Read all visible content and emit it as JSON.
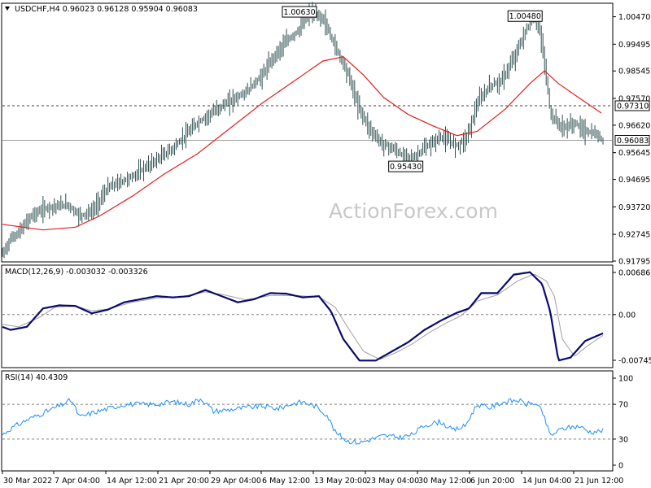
{
  "header": "USDCHF,H4  0.96023 0.96128 0.95904 0.96083",
  "watermark": "ActionForex.com",
  "colors": {
    "candle": "#2f4f4f",
    "ma": "#e41e1e",
    "macd": "#0a0a6e",
    "signal": "#a0a0a0",
    "rsi": "#1e90ff",
    "hline": "#808080"
  },
  "chart_data": [
    {
      "type": "line",
      "title": "USDCHF,H4",
      "price_axis": [
        "1.00470",
        "0.99495",
        "0.98545",
        "0.97570",
        "0.96620",
        "0.95645",
        "0.94695",
        "0.93720",
        "0.92745",
        "0.91795"
      ],
      "ylim": [
        0.91795,
        1.0092
      ],
      "x_labels": [
        "30 Mar 2022",
        "7 Apr 04:00",
        "14 Apr 12:00",
        "21 Apr 20:00",
        "29 Apr 04:00",
        "6 May 12:00",
        "13 May 20:00",
        "23 May 04:00",
        "30 May 12:00",
        "6 Jun 20:00",
        "14 Jun 04:00",
        "21 Jun 12:00"
      ],
      "price_knots": [
        [
          0,
          0.9205
        ],
        [
          10,
          0.926
        ],
        [
          20,
          0.928
        ],
        [
          35,
          0.934
        ],
        [
          55,
          0.937
        ],
        [
          80,
          0.938
        ],
        [
          95,
          0.934
        ],
        [
          110,
          0.9355
        ],
        [
          130,
          0.944
        ],
        [
          160,
          0.948
        ],
        [
          185,
          0.953
        ],
        [
          210,
          0.958
        ],
        [
          240,
          0.967
        ],
        [
          270,
          0.973
        ],
        [
          300,
          0.978
        ],
        [
          320,
          0.984
        ],
        [
          335,
          0.991
        ],
        [
          350,
          0.996
        ],
        [
          365,
          1.0
        ],
        [
          378,
          1.0063
        ],
        [
          395,
          1.004
        ],
        [
          410,
          0.994
        ],
        [
          425,
          0.985
        ],
        [
          438,
          0.973
        ],
        [
          452,
          0.965
        ],
        [
          466,
          0.96
        ],
        [
          480,
          0.958
        ],
        [
          495,
          0.955
        ],
        [
          505,
          0.9543
        ],
        [
          520,
          0.958
        ],
        [
          540,
          0.962
        ],
        [
          560,
          0.959
        ],
        [
          572,
          0.962
        ],
        [
          585,
          0.974
        ],
        [
          600,
          0.98
        ],
        [
          615,
          0.982
        ],
        [
          630,
          0.99
        ],
        [
          645,
          1.0
        ],
        [
          656,
          1.0048
        ],
        [
          662,
          1.0
        ],
        [
          670,
          0.983
        ],
        [
          675,
          0.97
        ],
        [
          690,
          0.965
        ],
        [
          705,
          0.967
        ],
        [
          718,
          0.964
        ],
        [
          730,
          0.963
        ],
        [
          741,
          0.9608
        ]
      ],
      "ma_knots": [
        [
          0,
          0.931
        ],
        [
          50,
          0.929
        ],
        [
          90,
          0.93
        ],
        [
          120,
          0.934
        ],
        [
          160,
          0.941
        ],
        [
          200,
          0.949
        ],
        [
          240,
          0.956
        ],
        [
          280,
          0.965
        ],
        [
          320,
          0.974
        ],
        [
          360,
          0.982
        ],
        [
          395,
          0.989
        ],
        [
          420,
          0.9905
        ],
        [
          445,
          0.984
        ],
        [
          470,
          0.976
        ],
        [
          500,
          0.97
        ],
        [
          530,
          0.966
        ],
        [
          560,
          0.9625
        ],
        [
          585,
          0.964
        ],
        [
          620,
          0.972
        ],
        [
          650,
          0.981
        ],
        [
          668,
          0.9855
        ],
        [
          685,
          0.981
        ],
        [
          710,
          0.976
        ],
        [
          738,
          0.9705
        ]
      ],
      "annotations": [
        {
          "text": "1.00630",
          "x": 378,
          "y": 1.0063
        },
        {
          "text": "0.95430",
          "x": 505,
          "y": 0.9543
        },
        {
          "text": "1.00480",
          "x": 656,
          "y": 1.0048
        }
      ],
      "hlines": [
        {
          "label": "0.97310",
          "y": 0.9731,
          "style": "dashed"
        },
        {
          "label": "0.96083",
          "y": 0.96083,
          "style": "solid"
        }
      ]
    },
    {
      "type": "line",
      "title": "MACD(12,26,9) -0.003032 -0.003326",
      "ylim": [
        -0.007454,
        0.006861
      ],
      "axis_labels": [
        "0.006861",
        "0.00",
        "-0.007454"
      ],
      "series": [
        {
          "values": [
            [
              0,
              -0.002
            ],
            [
              10,
              -0.0025
            ],
            [
              30,
              -0.002
            ],
            [
              50,
              0.001
            ],
            [
              70,
              0.0015
            ],
            [
              90,
              0.0014
            ],
            [
              110,
              0.0002
            ],
            [
              130,
              0.0008
            ],
            [
              150,
              0.002
            ],
            [
              170,
              0.0025
            ],
            [
              190,
              0.003
            ],
            [
              210,
              0.0028
            ],
            [
              230,
              0.003
            ],
            [
              250,
              0.004
            ],
            [
              270,
              0.003
            ],
            [
              290,
              0.002
            ],
            [
              310,
              0.0025
            ],
            [
              330,
              0.0035
            ],
            [
              350,
              0.0034
            ],
            [
              370,
              0.0028
            ],
            [
              390,
              0.003
            ],
            [
              405,
              0.0005
            ],
            [
              420,
              -0.004
            ],
            [
              440,
              -0.0075
            ],
            [
              460,
              -0.0075
            ],
            [
              480,
              -0.006
            ],
            [
              500,
              -0.0045
            ],
            [
              520,
              -0.0025
            ],
            [
              540,
              -0.001
            ],
            [
              560,
              0.0003
            ],
            [
              575,
              0.001
            ],
            [
              590,
              0.0035
            ],
            [
              610,
              0.0035
            ],
            [
              630,
              0.0065
            ],
            [
              650,
              0.0069
            ],
            [
              665,
              0.005
            ],
            [
              675,
              0.0005
            ],
            [
              685,
              -0.0075
            ],
            [
              700,
              -0.007
            ],
            [
              718,
              -0.0043
            ],
            [
              741,
              -0.003
            ]
          ]
        },
        {
          "values": [
            [
              0,
              -0.0016
            ],
            [
              20,
              -0.002
            ],
            [
              45,
              -0.0005
            ],
            [
              65,
              0.0012
            ],
            [
              90,
              0.0014
            ],
            [
              110,
              0.0006
            ],
            [
              130,
              0.0009
            ],
            [
              160,
              0.002
            ],
            [
              190,
              0.0027
            ],
            [
              220,
              0.0029
            ],
            [
              250,
              0.0037
            ],
            [
              270,
              0.0033
            ],
            [
              300,
              0.0024
            ],
            [
              330,
              0.0031
            ],
            [
              360,
              0.0031
            ],
            [
              390,
              0.0029
            ],
            [
              410,
              0.0012
            ],
            [
              425,
              -0.002
            ],
            [
              445,
              -0.006
            ],
            [
              465,
              -0.0073
            ],
            [
              485,
              -0.0062
            ],
            [
              505,
              -0.0048
            ],
            [
              525,
              -0.003
            ],
            [
              545,
              -0.0015
            ],
            [
              565,
              -0.0002
            ],
            [
              585,
              0.0022
            ],
            [
              610,
              0.0032
            ],
            [
              635,
              0.0055
            ],
            [
              655,
              0.0066
            ],
            [
              670,
              0.0055
            ],
            [
              680,
              0.003
            ],
            [
              690,
              -0.004
            ],
            [
              705,
              -0.0068
            ],
            [
              720,
              -0.0052
            ],
            [
              741,
              -0.0033
            ]
          ]
        }
      ]
    },
    {
      "type": "line",
      "title": "RSI(14) 40.4309",
      "ylim": [
        0,
        100
      ],
      "axis_labels": [
        "100",
        "70",
        "30",
        "0"
      ],
      "hlines": [
        70,
        30
      ],
      "values": [
        [
          0,
          35
        ],
        [
          10,
          42
        ],
        [
          30,
          52
        ],
        [
          50,
          60
        ],
        [
          70,
          68
        ],
        [
          85,
          75
        ],
        [
          95,
          55
        ],
        [
          110,
          60
        ],
        [
          130,
          65
        ],
        [
          150,
          70
        ],
        [
          170,
          70
        ],
        [
          190,
          70
        ],
        [
          210,
          73
        ],
        [
          230,
          70
        ],
        [
          245,
          77
        ],
        [
          260,
          62
        ],
        [
          280,
          64
        ],
        [
          300,
          66
        ],
        [
          320,
          68
        ],
        [
          340,
          65
        ],
        [
          355,
          70
        ],
        [
          370,
          73
        ],
        [
          385,
          68
        ],
        [
          400,
          58
        ],
        [
          410,
          38
        ],
        [
          425,
          28
        ],
        [
          440,
          26
        ],
        [
          455,
          30
        ],
        [
          470,
          34
        ],
        [
          490,
          32
        ],
        [
          505,
          35
        ],
        [
          520,
          46
        ],
        [
          540,
          50
        ],
        [
          555,
          40
        ],
        [
          570,
          45
        ],
        [
          585,
          70
        ],
        [
          600,
          66
        ],
        [
          615,
          72
        ],
        [
          635,
          75
        ],
        [
          645,
          70
        ],
        [
          655,
          72
        ],
        [
          665,
          62
        ],
        [
          675,
          34
        ],
        [
          690,
          42
        ],
        [
          710,
          45
        ],
        [
          725,
          38
        ],
        [
          741,
          40
        ]
      ]
    }
  ]
}
